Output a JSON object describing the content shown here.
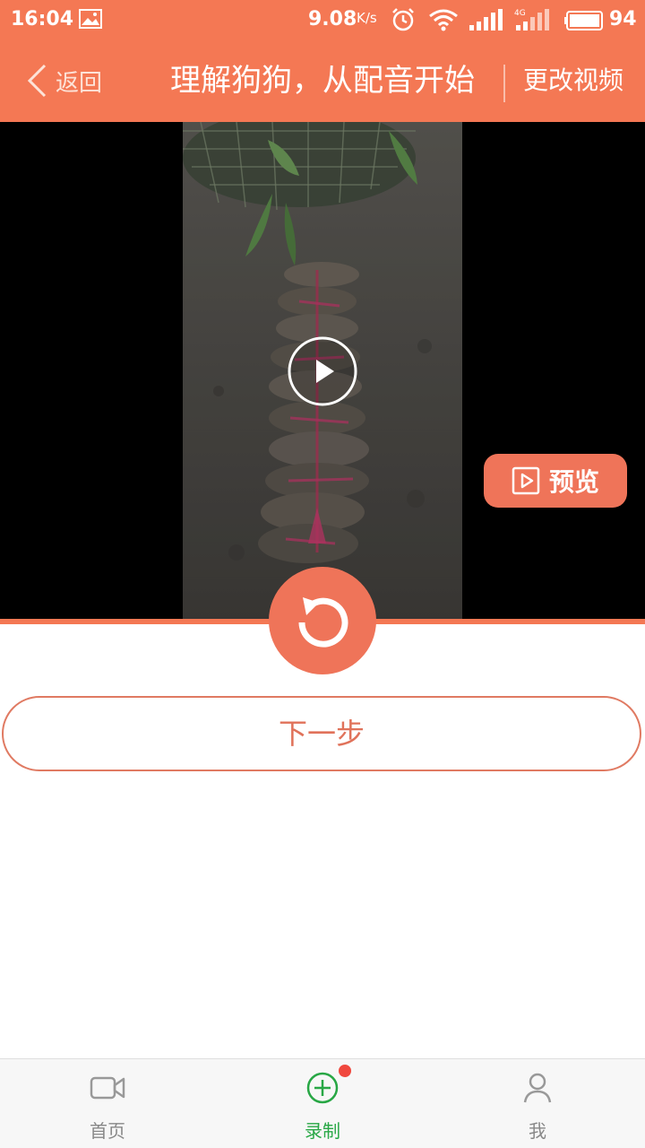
{
  "status_bar": {
    "time": "16:04",
    "speed": "9.08",
    "speed_unit": "K/s",
    "battery": "94"
  },
  "header": {
    "back_label": "返回",
    "title": "理解狗狗，从配音开始",
    "change_video_label": "更改视频"
  },
  "player": {
    "preview_label": "预览"
  },
  "actions": {
    "next_label": "下一步"
  },
  "tabs": [
    {
      "label": "首页",
      "icon": "video-camera-icon"
    },
    {
      "label": "录制",
      "icon": "plus-circle-icon"
    },
    {
      "label": "我",
      "icon": "person-icon"
    }
  ],
  "colors": {
    "accent": "#f47854",
    "active_tab": "#28a745",
    "badge": "#f0483e"
  }
}
